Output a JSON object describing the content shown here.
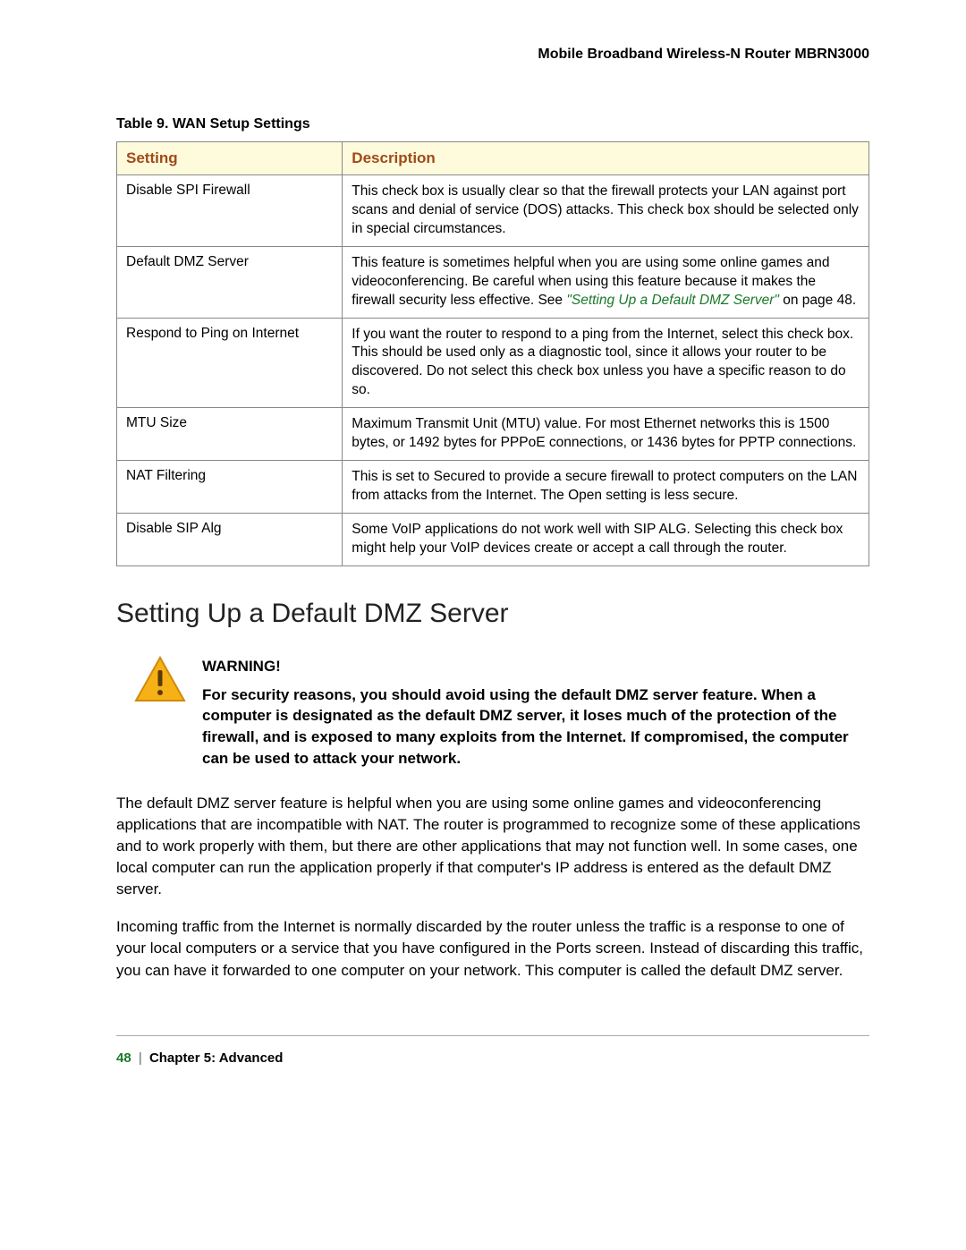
{
  "header": {
    "product": "Mobile Broadband Wireless-N Router MBRN3000"
  },
  "table": {
    "caption": "Table 9.  WAN Setup Settings",
    "columns": {
      "setting": "Setting",
      "description": "Description"
    },
    "rows": [
      {
        "setting": "Disable SPI Firewall",
        "description": "This check box is usually clear so that the firewall protects your LAN against port scans and denial of service (DOS) attacks. This check box should be selected only in special circumstances."
      },
      {
        "setting": "Default DMZ Server",
        "description_prefix": "This feature is sometimes helpful when you are using some online games and videoconferencing. Be careful when using this feature because it makes the firewall security less effective. See ",
        "link_text": "\"Setting Up a Default DMZ Server\"",
        "description_suffix": " on page 48."
      },
      {
        "setting": "Respond to Ping on Internet",
        "description": "If you want the router to respond to a ping from the Internet, select this check box. This should be used only as a diagnostic tool, since it allows your router to be discovered. Do not select this check box unless you have a specific reason to do so."
      },
      {
        "setting": "MTU Size",
        "description": "Maximum Transmit Unit (MTU) value. For most Ethernet networks this is 1500 bytes, or 1492 bytes for PPPoE connections, or 1436 bytes for PPTP connections."
      },
      {
        "setting": "NAT Filtering",
        "description": "This is set to Secured to provide a secure firewall to protect computers on the LAN from attacks from the Internet. The Open setting is less secure."
      },
      {
        "setting": "Disable SIP Alg",
        "description": "Some VoIP applications do not work well with SIP ALG. Selecting this check box might help your VoIP devices create or accept a call through the router."
      }
    ]
  },
  "section": {
    "title": "Setting Up a Default DMZ Server"
  },
  "warning": {
    "label": "WARNING!",
    "body": "For security reasons, you should avoid using the default DMZ server feature. When a computer is designated as the default DMZ server, it loses much of the protection of the firewall, and is exposed to many exploits from the Internet. If compromised, the computer can be used to attack your network."
  },
  "paragraphs": {
    "p1": "The default DMZ server feature is helpful when you are using some online games and videoconferencing applications that are incompatible with NAT. The router is programmed to recognize some of these applications and to work properly with them, but there are other applications that may not function well. In some cases, one local computer can run the application properly if that computer's IP address is entered as the default DMZ server.",
    "p2": "Incoming traffic from the Internet is normally discarded by the router unless the traffic is a response to one of your local computers or a service that you have configured in the Ports screen. Instead of discarding this traffic, you can have it forwarded to one computer on your network. This computer is called the default DMZ server."
  },
  "footer": {
    "page": "48",
    "chapter": "Chapter 5:  Advanced"
  }
}
